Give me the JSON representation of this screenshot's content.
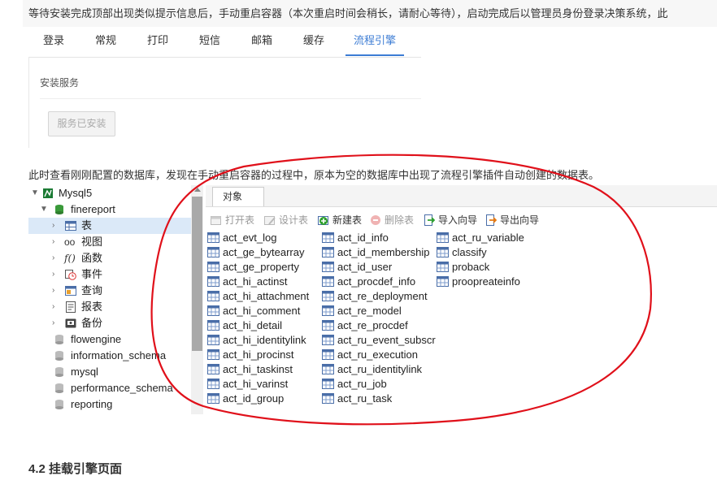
{
  "intro_text": "等待安装完成顶部出现类似提示信息后，手动重启容器（本次重启时间会稍长，请耐心等待），启动完成后以管理员身份登录决策系统，此",
  "settings": {
    "tabs": [
      "登录",
      "常规",
      "打印",
      "短信",
      "邮箱",
      "缓存",
      "流程引擎"
    ],
    "active_tab": "流程引擎",
    "section_title": "安装服务",
    "install_button": "服务已安装"
  },
  "description": "此时查看刚刚配置的数据库，发现在手动重启容器的过程中，原本为空的数据库中出现了流程引擎插件自动创建的数据表。",
  "tree": {
    "connection": "Mysql5",
    "database": "finereport",
    "nodes": [
      "表",
      "视图",
      "函数",
      "事件",
      "查询",
      "报表",
      "备份"
    ],
    "other_databases": [
      "flowengine",
      "information_schema",
      "mysql",
      "performance_schema",
      "reporting"
    ]
  },
  "object_panel": {
    "tab": "对象",
    "toolbar": {
      "open_table": "打开表",
      "design_table": "设计表",
      "new_table": "新建表",
      "delete_table": "删除表",
      "import_wizard": "导入向导",
      "export_wizard": "导出向导"
    },
    "tables_col1": [
      "act_evt_log",
      "act_ge_bytearray",
      "act_ge_property",
      "act_hi_actinst",
      "act_hi_attachment",
      "act_hi_comment",
      "act_hi_detail",
      "act_hi_identitylink",
      "act_hi_procinst",
      "act_hi_taskinst",
      "act_hi_varinst",
      "act_id_group"
    ],
    "tables_col2": [
      "act_id_info",
      "act_id_membership",
      "act_id_user",
      "act_procdef_info",
      "act_re_deployment",
      "act_re_model",
      "act_re_procdef",
      "act_ru_event_subscr",
      "act_ru_execution",
      "act_ru_identitylink",
      "act_ru_job",
      "act_ru_task"
    ],
    "tables_col3": [
      "act_ru_variable",
      "classify",
      "proback",
      "proopreateinfo"
    ]
  },
  "heading": "4.2 挂载引擎页面",
  "colors": {
    "accent": "#3c7cd4",
    "annotation": "#e0101a",
    "selection": "#dbe9f8"
  }
}
